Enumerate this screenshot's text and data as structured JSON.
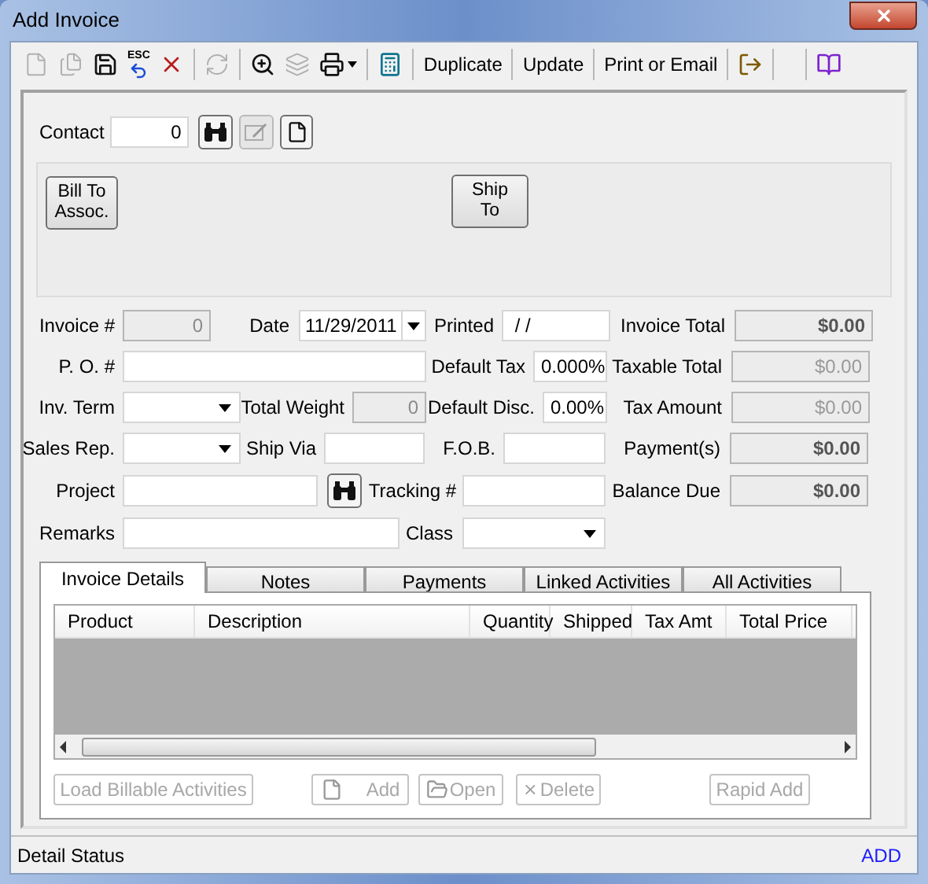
{
  "window": {
    "title": "Add Invoice"
  },
  "toolbar": {
    "items": [
      {
        "kind": "icon",
        "disabled": true
      },
      {
        "kind": "icon",
        "disabled": true
      },
      {
        "kind": "icon",
        "disabled": false
      },
      {
        "kind": "icon",
        "disabled": false,
        "caption": "ESC"
      },
      {
        "kind": "icon",
        "disabled": false
      },
      {
        "kind": "separator"
      },
      {
        "kind": "icon",
        "disabled": true
      },
      {
        "kind": "separator"
      },
      {
        "kind": "icon",
        "disabled": false
      },
      {
        "kind": "icon",
        "disabled": true
      },
      {
        "kind": "icon",
        "disabled": false,
        "has_menu": true
      },
      {
        "kind": "separator"
      },
      {
        "kind": "icon",
        "disabled": false
      },
      {
        "kind": "separator"
      },
      {
        "kind": "text",
        "label": "Duplicate"
      },
      {
        "kind": "separator"
      },
      {
        "kind": "text",
        "label": "Update"
      },
      {
        "kind": "separator"
      },
      {
        "kind": "text",
        "label": "Print or Email"
      },
      {
        "kind": "separator"
      },
      {
        "kind": "icon",
        "disabled": false
      },
      {
        "kind": "separator"
      },
      {
        "kind": "spacer"
      },
      {
        "kind": "separator"
      },
      {
        "kind": "icon",
        "disabled": false
      }
    ]
  },
  "contact": {
    "label": "Contact",
    "value": "0",
    "note_disabled": true
  },
  "address_buttons": [
    {
      "label": "Bill To Assoc."
    },
    {
      "label": "Ship To"
    }
  ],
  "form": {
    "invoice_no": {
      "label": "Invoice #",
      "value": "0",
      "disabled": true
    },
    "date": {
      "label": "Date",
      "value": "11/29/2011"
    },
    "printed": {
      "label": "Printed",
      "value": " / /"
    },
    "po": {
      "label": "P. O. #"
    },
    "default_tax": {
      "label": "Default Tax",
      "value": "0.000%"
    },
    "inv_term": {
      "label": "Inv. Term"
    },
    "total_weight": {
      "label": "Total Weight",
      "value": "0",
      "disabled": true
    },
    "default_disc": {
      "label": "Default Disc.",
      "value": "0.00%"
    },
    "sales_rep": {
      "label": "Sales Rep."
    },
    "ship_via": {
      "label": "Ship Via"
    },
    "fob": {
      "label": "F.O.B."
    },
    "project": {
      "label": "Project"
    },
    "tracking": {
      "label": "Tracking #"
    },
    "remarks": {
      "label": "Remarks"
    },
    "class": {
      "label": "Class"
    }
  },
  "totals": [
    {
      "label": "Invoice Total",
      "value": "$0.00",
      "emphasized": true
    },
    {
      "label": "Taxable Total",
      "value": "$0.00",
      "emphasized": false
    },
    {
      "label": "Tax Amount",
      "value": "$0.00",
      "emphasized": false
    },
    {
      "label": "Payment(s)",
      "value": "$0.00",
      "emphasized": true
    },
    {
      "label": "Balance Due",
      "value": "$0.00",
      "emphasized": true
    }
  ],
  "tabs": [
    {
      "label": "Invoice Details",
      "selected": true
    },
    {
      "label": "Notes",
      "selected": false
    },
    {
      "label": "Payments",
      "selected": false
    },
    {
      "label": "Linked Activities",
      "selected": false
    },
    {
      "label": "All Activities",
      "selected": false
    }
  ],
  "table": {
    "columns": [
      "Product",
      "Description",
      "Quantity",
      "Shipped",
      "Tax Amt",
      "Total Price"
    ]
  },
  "detail_buttons": [
    {
      "label": "Load Billable Activities",
      "kind": "plain",
      "disabled": true
    },
    {
      "label": "Add",
      "kind": "add",
      "disabled": true
    },
    {
      "label": "Open",
      "kind": "open",
      "disabled": true
    },
    {
      "label": "Delete",
      "kind": "delete",
      "disabled": true
    },
    {
      "label": "Rapid Add",
      "kind": "plain",
      "disabled": true
    }
  ],
  "status_bar": {
    "label": "Detail Status",
    "mode": "ADD"
  }
}
